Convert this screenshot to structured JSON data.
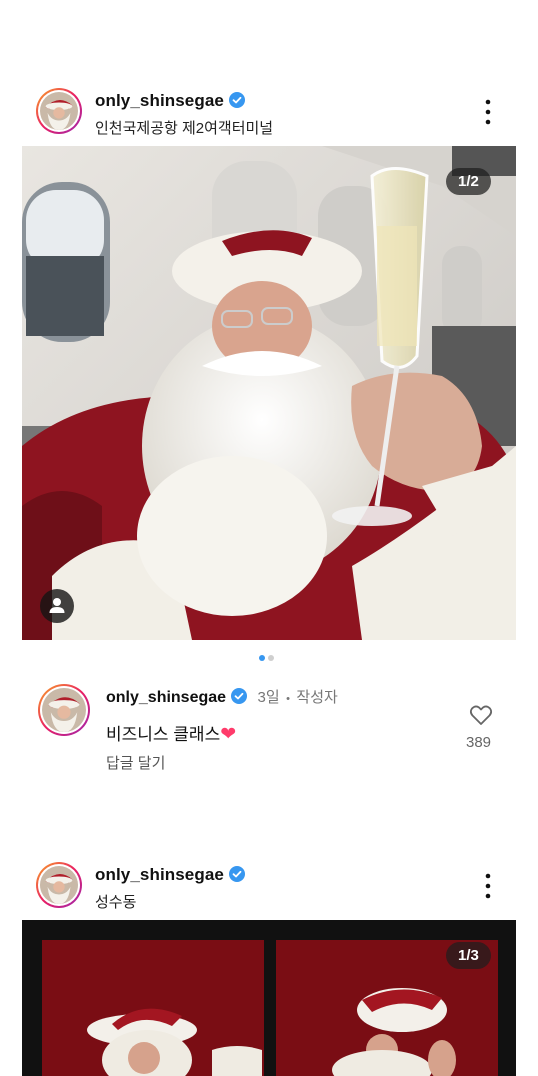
{
  "post1": {
    "username": "only_shinsegae",
    "location": "인천국제공항 제2여객터미널",
    "counter": "1/2"
  },
  "comment": {
    "username": "only_shinsegae",
    "time": "3일",
    "separator": "•",
    "role": "작성자",
    "text": "비즈니스 클래스",
    "emoji": "❤",
    "reply": "답글 달기",
    "likes": "389"
  },
  "post2": {
    "username": "only_shinsegae",
    "location": "성수동",
    "counter": "1/3"
  },
  "colors": {
    "accent_blue": "#3797f0",
    "heart_pink": "#ff3b6b",
    "santa_red": "#8e1420"
  },
  "icons": [
    "verified-badge-icon",
    "more-options-icon",
    "user-tag-icon",
    "heart-icon"
  ]
}
